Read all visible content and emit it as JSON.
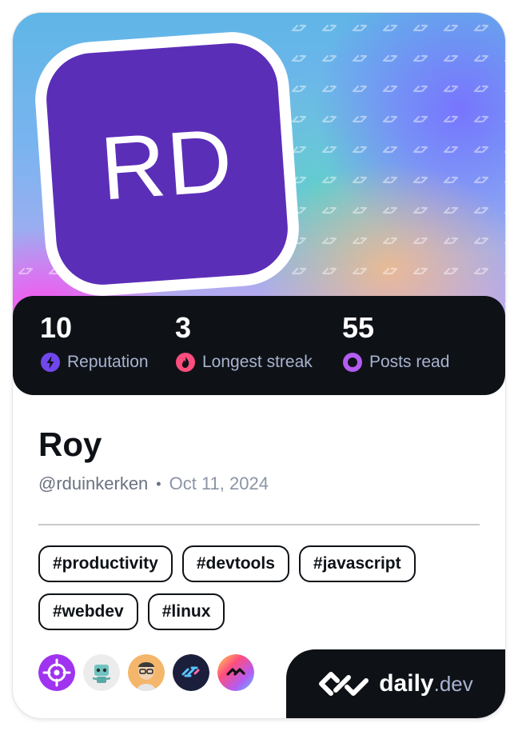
{
  "profile": {
    "initials": "RD",
    "name": "Roy",
    "handle": "@rduinkerken",
    "separator": "•",
    "joined": "Oct 11, 2024"
  },
  "stats": [
    {
      "value": "10",
      "label": "Reputation",
      "icon": "lightning-icon",
      "color": "#7147ed"
    },
    {
      "value": "3",
      "label": "Longest streak",
      "icon": "flame-icon",
      "color": "#ff4d7e"
    },
    {
      "value": "55",
      "label": "Posts read",
      "icon": "eye-ring-icon",
      "color": "#b45cf2"
    }
  ],
  "tags": [
    "#productivity",
    "#devtools",
    "#javascript",
    "#webdev",
    "#linux"
  ],
  "sources": [
    {
      "icon": "crosshair-source-icon",
      "color": "#a033f0"
    },
    {
      "icon": "robot-source-icon",
      "color": "#e8e8e8"
    },
    {
      "icon": "memoji-source-icon",
      "color": "#f4b66a"
    },
    {
      "icon": "daily-logo-source-icon",
      "color": "#1b1f3b"
    },
    {
      "icon": "gradient-logo-source-icon",
      "color": "#ff6ab0"
    }
  ],
  "brand": {
    "word": "daily",
    "tld": ".dev"
  }
}
